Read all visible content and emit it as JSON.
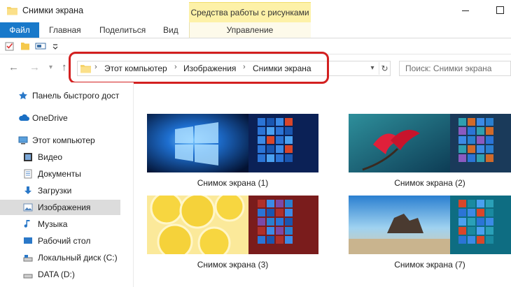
{
  "window": {
    "title": "Снимки экрана",
    "contextual_group": "Средства работы с рисунками"
  },
  "ribbon": {
    "tabs": [
      {
        "id": "file",
        "label": "Файл"
      },
      {
        "id": "home",
        "label": "Главная"
      },
      {
        "id": "share",
        "label": "Поделиться"
      },
      {
        "id": "view",
        "label": "Вид"
      },
      {
        "id": "manage",
        "label": "Управление"
      }
    ]
  },
  "address_bar": {
    "breadcrumbs": [
      "Этот компьютер",
      "Изображения",
      "Снимки экрана"
    ],
    "separator": "›"
  },
  "search": {
    "placeholder": "Поиск: Снимки экрана"
  },
  "sidebar": {
    "items": [
      {
        "label": "Панель быстрого дост",
        "icon": "star-icon",
        "indent": 0
      },
      {
        "label": "OneDrive",
        "icon": "cloud-icon",
        "indent": 0
      },
      {
        "label": "Этот компьютер",
        "icon": "computer-icon",
        "indent": 0
      },
      {
        "label": "Видео",
        "icon": "video-icon",
        "indent": 1
      },
      {
        "label": "Документы",
        "icon": "documents-icon",
        "indent": 1
      },
      {
        "label": "Загрузки",
        "icon": "downloads-icon",
        "indent": 1
      },
      {
        "label": "Изображения",
        "icon": "pictures-icon",
        "indent": 1,
        "selected": true
      },
      {
        "label": "Музыка",
        "icon": "music-icon",
        "indent": 1
      },
      {
        "label": "Рабочий стол",
        "icon": "desktop-icon",
        "indent": 1
      },
      {
        "label": "Локальный диск (C:)",
        "icon": "drive-icon",
        "indent": 1
      },
      {
        "label": "DATA (D:)",
        "icon": "drive-icon",
        "indent": 1
      }
    ]
  },
  "files": [
    {
      "name": "Снимок экрана (1)",
      "wallpaper": "windows-hero"
    },
    {
      "name": "Снимок экрана (2)",
      "wallpaper": "red-flower"
    },
    {
      "name": "Снимок экрана (3)",
      "wallpaper": "lemon-slices"
    },
    {
      "name": "Снимок экрана (7)",
      "wallpaper": "beach-rocks"
    }
  ],
  "colors": {
    "file_tab": "#1979ca",
    "context_tab": "#fdf1a8",
    "highlight": "#d32020",
    "selected_item": "#dcdcdc"
  }
}
